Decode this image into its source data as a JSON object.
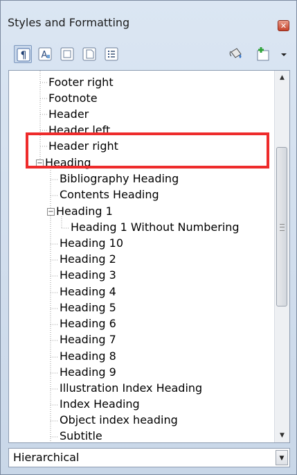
{
  "window": {
    "title": "Styles and Formatting"
  },
  "toolbar": {
    "buttons": [
      {
        "name": "paragraph-styles-icon",
        "active": true
      },
      {
        "name": "character-styles-icon"
      },
      {
        "name": "frame-styles-icon"
      },
      {
        "name": "page-styles-icon"
      },
      {
        "name": "list-styles-icon"
      },
      {
        "name": "fill-format-mode-icon"
      },
      {
        "name": "new-style-from-selection-icon"
      }
    ]
  },
  "tree": {
    "items": [
      {
        "label": "Footer right",
        "level": 1
      },
      {
        "label": "Footnote",
        "level": 1
      },
      {
        "label": "Header",
        "level": 1
      },
      {
        "label": "Header left",
        "level": 1
      },
      {
        "label": "Header right",
        "level": 1
      },
      {
        "label": "Heading",
        "level": 0,
        "expanded": true
      },
      {
        "label": "Bibliography Heading",
        "level": 1
      },
      {
        "label": "Contents Heading",
        "level": 1
      },
      {
        "label": "Heading 1",
        "level": 1,
        "expanded": true
      },
      {
        "label": "Heading 1 Without Numbering",
        "level": 2
      },
      {
        "label": "Heading 10",
        "level": 1
      },
      {
        "label": "Heading 2",
        "level": 1
      },
      {
        "label": "Heading 3",
        "level": 1
      },
      {
        "label": "Heading 4",
        "level": 1
      },
      {
        "label": "Heading 5",
        "level": 1
      },
      {
        "label": "Heading 6",
        "level": 1
      },
      {
        "label": "Heading 7",
        "level": 1
      },
      {
        "label": "Heading 8",
        "level": 1
      },
      {
        "label": "Heading 9",
        "level": 1
      },
      {
        "label": "Illustration Index Heading",
        "level": 1
      },
      {
        "label": "Index Heading",
        "level": 1
      },
      {
        "label": "Object index heading",
        "level": 1
      },
      {
        "label": "Subtitle",
        "level": 1
      }
    ]
  },
  "filter": {
    "value": "Hierarchical"
  },
  "colors": {
    "highlight": "#ee2b2b",
    "titlebar": "#dbe6f3",
    "accent": "#7e99bf"
  }
}
